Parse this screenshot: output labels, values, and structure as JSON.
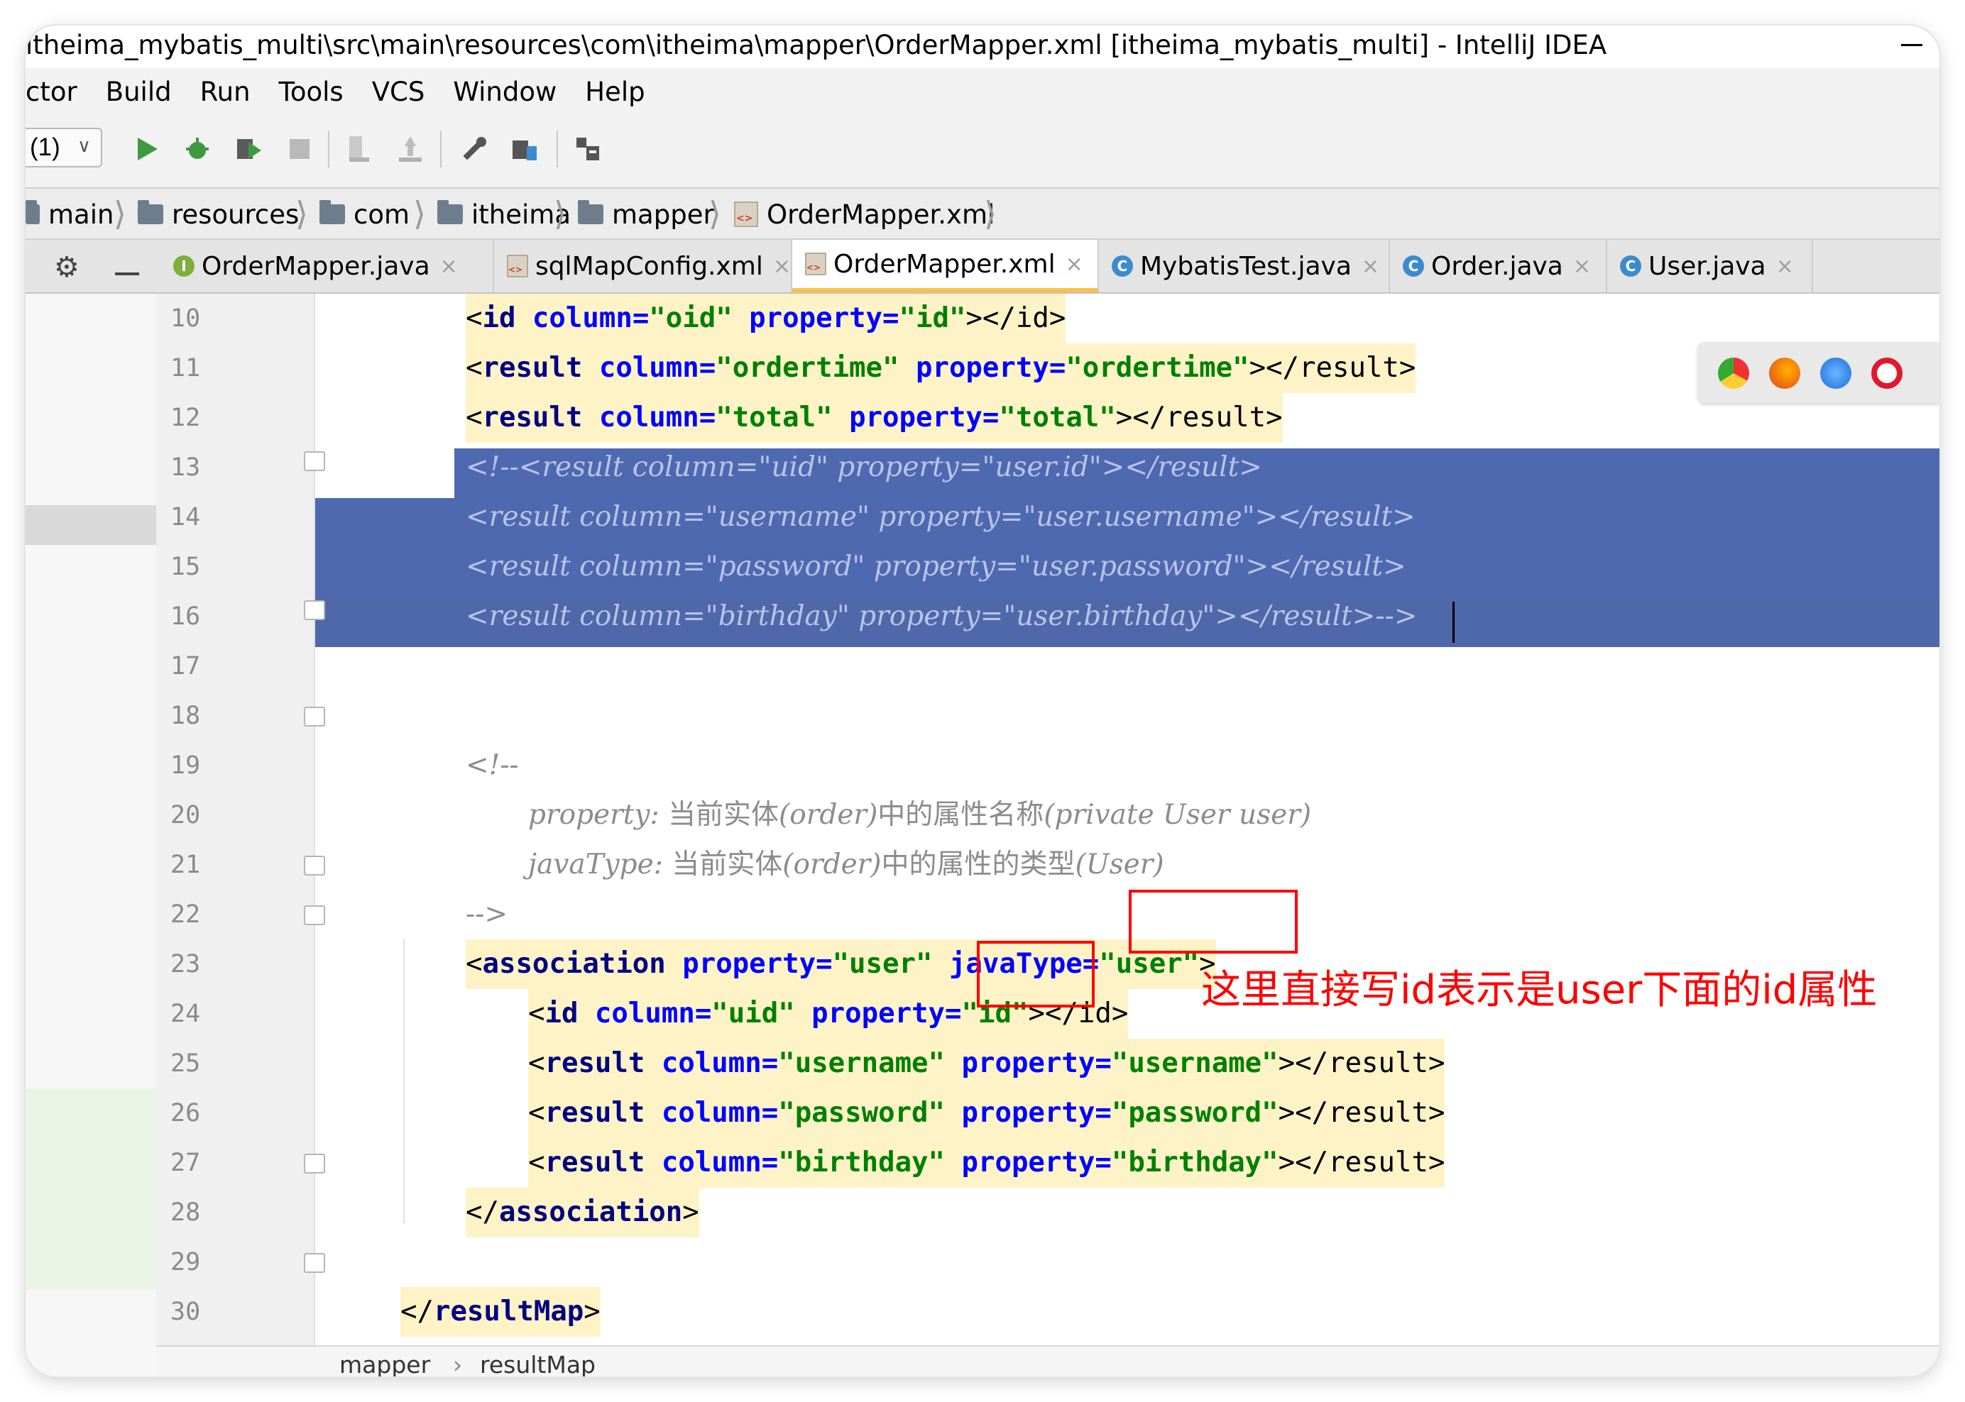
{
  "window": {
    "title": "ıtheima_mybatis_multi\\src\\main\\resources\\com\\itheima\\mapper\\OrderMapper.xml [itheima_mybatis_multi] - IntelliJ IDEA"
  },
  "menu": [
    "ctor",
    "Build",
    "Run",
    "Tools",
    "VCS",
    "Window",
    "Help"
  ],
  "toolbar": {
    "run_config": "(1)",
    "icons": [
      "run-icon",
      "debug-icon",
      "coverage-icon",
      "stop-icon",
      "build-icon",
      "deploy-icon",
      "wrench-icon",
      "project-structure-icon",
      "vcs-icon"
    ]
  },
  "breadcrumb": [
    "main",
    "resources",
    "com",
    "itheima",
    "mapper",
    "OrderMapper.xml"
  ],
  "tabs": [
    {
      "label": "OrderMapper.java",
      "icon": "interface-icon",
      "active": false
    },
    {
      "label": "sqlMapConfig.xml",
      "icon": "xml-icon",
      "active": false
    },
    {
      "label": "OrderMapper.xml",
      "icon": "xml-icon",
      "active": true
    },
    {
      "label": "MybatisTest.java",
      "icon": "class-icon",
      "active": false
    },
    {
      "label": "Order.java",
      "icon": "class-icon",
      "active": false
    },
    {
      "label": "User.java",
      "icon": "class-icon",
      "active": false
    }
  ],
  "line_numbers": [
    "10",
    "11",
    "12",
    "13",
    "14",
    "15",
    "16",
    "17",
    "18",
    "19",
    "20",
    "21",
    "22",
    "23",
    "24",
    "25",
    "26",
    "27",
    "28",
    "29",
    "30"
  ],
  "code": {
    "l10": {
      "open": "<",
      "tag": "id",
      "a1": " column=",
      "v1": "\"oid\"",
      "a2": " property=",
      "v2": "\"id\"",
      "close": "></id>"
    },
    "l11": {
      "open": "<",
      "tag": "result",
      "a1": " column=",
      "v1": "\"ordertime\"",
      "a2": " property=",
      "v2": "\"ordertime\"",
      "close": "></result>"
    },
    "l12": {
      "open": "<",
      "tag": "result",
      "a1": " column=",
      "v1": "\"total\"",
      "a2": " property=",
      "v2": "\"total\"",
      "close": "></result>"
    },
    "l13": "<!--<result column=\"uid\" property=\"user.id\"></result>",
    "l14": "<result column=\"username\" property=\"user.username\"></result>",
    "l15": "<result column=\"password\" property=\"user.password\"></result>",
    "l16": "<result column=\"birthday\" property=\"user.birthday\"></result>-->",
    "l18": "<!--",
    "l19_key": "property: ",
    "l19_cn1": "当前实体",
    "l19_mid": "(order)",
    "l19_cn2": "中的属性名称",
    "l19_end": "(private User user)",
    "l20_key": "javaType: ",
    "l20_cn1": "当前实体",
    "l20_mid": "(order)",
    "l20_cn2": "中的属性的类型",
    "l20_end": "(User)",
    "l21": "-->",
    "l22": {
      "open": "<",
      "tag": "association",
      "a1": " property=",
      "v1": "\"user\"",
      "a2": " javaType=",
      "v2": "\"user\"",
      "close": ">"
    },
    "l23": {
      "open": "<",
      "tag": "id",
      "a1": " column=",
      "v1": "\"uid\"",
      "a2": " property=",
      "v2": "\"id\"",
      "close": "></id>"
    },
    "l24": {
      "open": "<",
      "tag": "result",
      "a1": " column=",
      "v1": "\"username\"",
      "a2": " property=",
      "v2": "\"username\"",
      "close": "></result>"
    },
    "l25": {
      "open": "<",
      "tag": "result",
      "a1": " column=",
      "v1": "\"password\"",
      "a2": " property=",
      "v2": "\"password\"",
      "close": "></result>"
    },
    "l26": {
      "open": "<",
      "tag": "result",
      "a1": " column=",
      "v1": "\"birthday\"",
      "a2": " property=",
      "v2": "\"birthday\"",
      "close": "></result>"
    },
    "l27": {
      "open": "</",
      "tag": "association",
      "close": ">"
    },
    "l29": {
      "open": "</",
      "tag": "resultMap",
      "close": ">"
    }
  },
  "annotation": "这里直接写id表示是user下面的id属性",
  "status_breadcrumb": [
    "mapper",
    "resultMap"
  ],
  "browser_icons": [
    "chrome-icon",
    "firefox-icon",
    "safari-icon",
    "opera-icon"
  ],
  "colors": {
    "selection": "#1d3f9a",
    "highlight": "#fdf3c7",
    "annotation": "#ff0000",
    "tag": "#000080",
    "attr": "#0000ff",
    "value": "#008000"
  }
}
